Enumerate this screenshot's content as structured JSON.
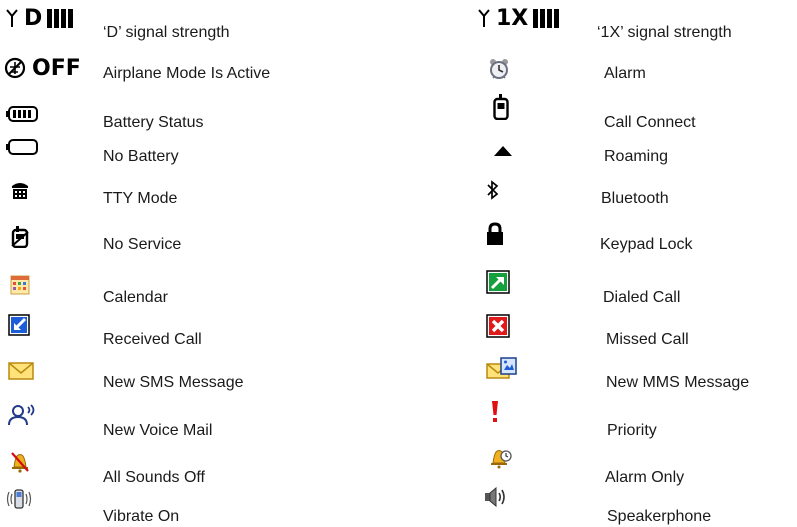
{
  "left_column": [
    {
      "icon": "d-signal-icon",
      "icon_text": "D",
      "label": "‘D’ signal strength"
    },
    {
      "icon": "airplane-mode-icon",
      "icon_text": "OFF",
      "label": "Airplane Mode Is Active"
    },
    {
      "icon": "battery-full-icon",
      "label": "Battery Status"
    },
    {
      "icon": "battery-empty-icon",
      "label": "No Battery"
    },
    {
      "icon": "tty-icon",
      "label": "TTY Mode"
    },
    {
      "icon": "no-service-icon",
      "label": "No Service"
    },
    {
      "icon": "calendar-icon",
      "label": "Calendar"
    },
    {
      "icon": "received-call-icon",
      "label": "Received Call"
    },
    {
      "icon": "sms-envelope-icon",
      "label": "New SMS Message"
    },
    {
      "icon": "voice-mail-icon",
      "label": "New Voice Mail"
    },
    {
      "icon": "sounds-off-bell-icon",
      "label": "All Sounds Off"
    },
    {
      "icon": "vibrate-phone-icon",
      "label": "Vibrate On"
    }
  ],
  "right_column": [
    {
      "icon": "1x-signal-icon",
      "icon_text": "1X",
      "label": "‘1X’ signal strength"
    },
    {
      "icon": "alarm-clock-icon",
      "label": "Alarm"
    },
    {
      "icon": "call-connect-icon",
      "label": "Call Connect"
    },
    {
      "icon": "roaming-triangle-icon",
      "label": "Roaming"
    },
    {
      "icon": "bluetooth-icon",
      "label": "Bluetooth"
    },
    {
      "icon": "padlock-icon",
      "label": "Keypad Lock"
    },
    {
      "icon": "dialed-call-icon",
      "label": "Dialed Call"
    },
    {
      "icon": "missed-call-icon",
      "label": "Missed Call"
    },
    {
      "icon": "mms-envelope-icon",
      "label": "New MMS Message"
    },
    {
      "icon": "priority-exclamation-icon",
      "label": "Priority"
    },
    {
      "icon": "alarm-only-bell-icon",
      "label": "Alarm Only"
    },
    {
      "icon": "speakerphone-icon",
      "label": "Speakerphone"
    }
  ]
}
